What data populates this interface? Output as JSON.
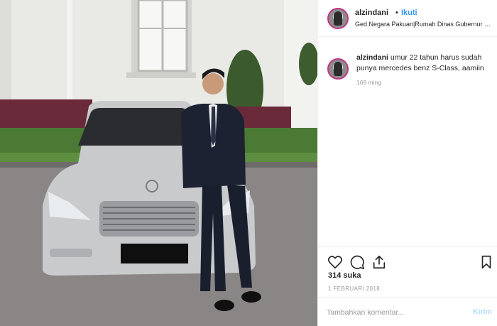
{
  "post": {
    "username": "alzindani",
    "separator": "•",
    "follow_label": "Ikuti",
    "location": "Ged.Negara Pakuan|Rumah Dinas Gubernur J..."
  },
  "caption": {
    "username": "alzindani",
    "text": "umur 22 tahun harus sudah punya mercedes benz S-Class, aamiin",
    "time_ago": "169 ming"
  },
  "engagement": {
    "likes": "314 suka",
    "date": "1 FEBRUARI 2018"
  },
  "comment": {
    "placeholder": "Tambahkan komentar...",
    "post_label": "Kirim"
  },
  "icons": {
    "like": "heart-icon",
    "comment": "comment-icon",
    "share": "share-icon",
    "save": "bookmark-icon"
  },
  "colors": {
    "follow": "#3897f0",
    "text": "#262626",
    "muted": "#999999",
    "post_disabled": "#b3dbff"
  }
}
